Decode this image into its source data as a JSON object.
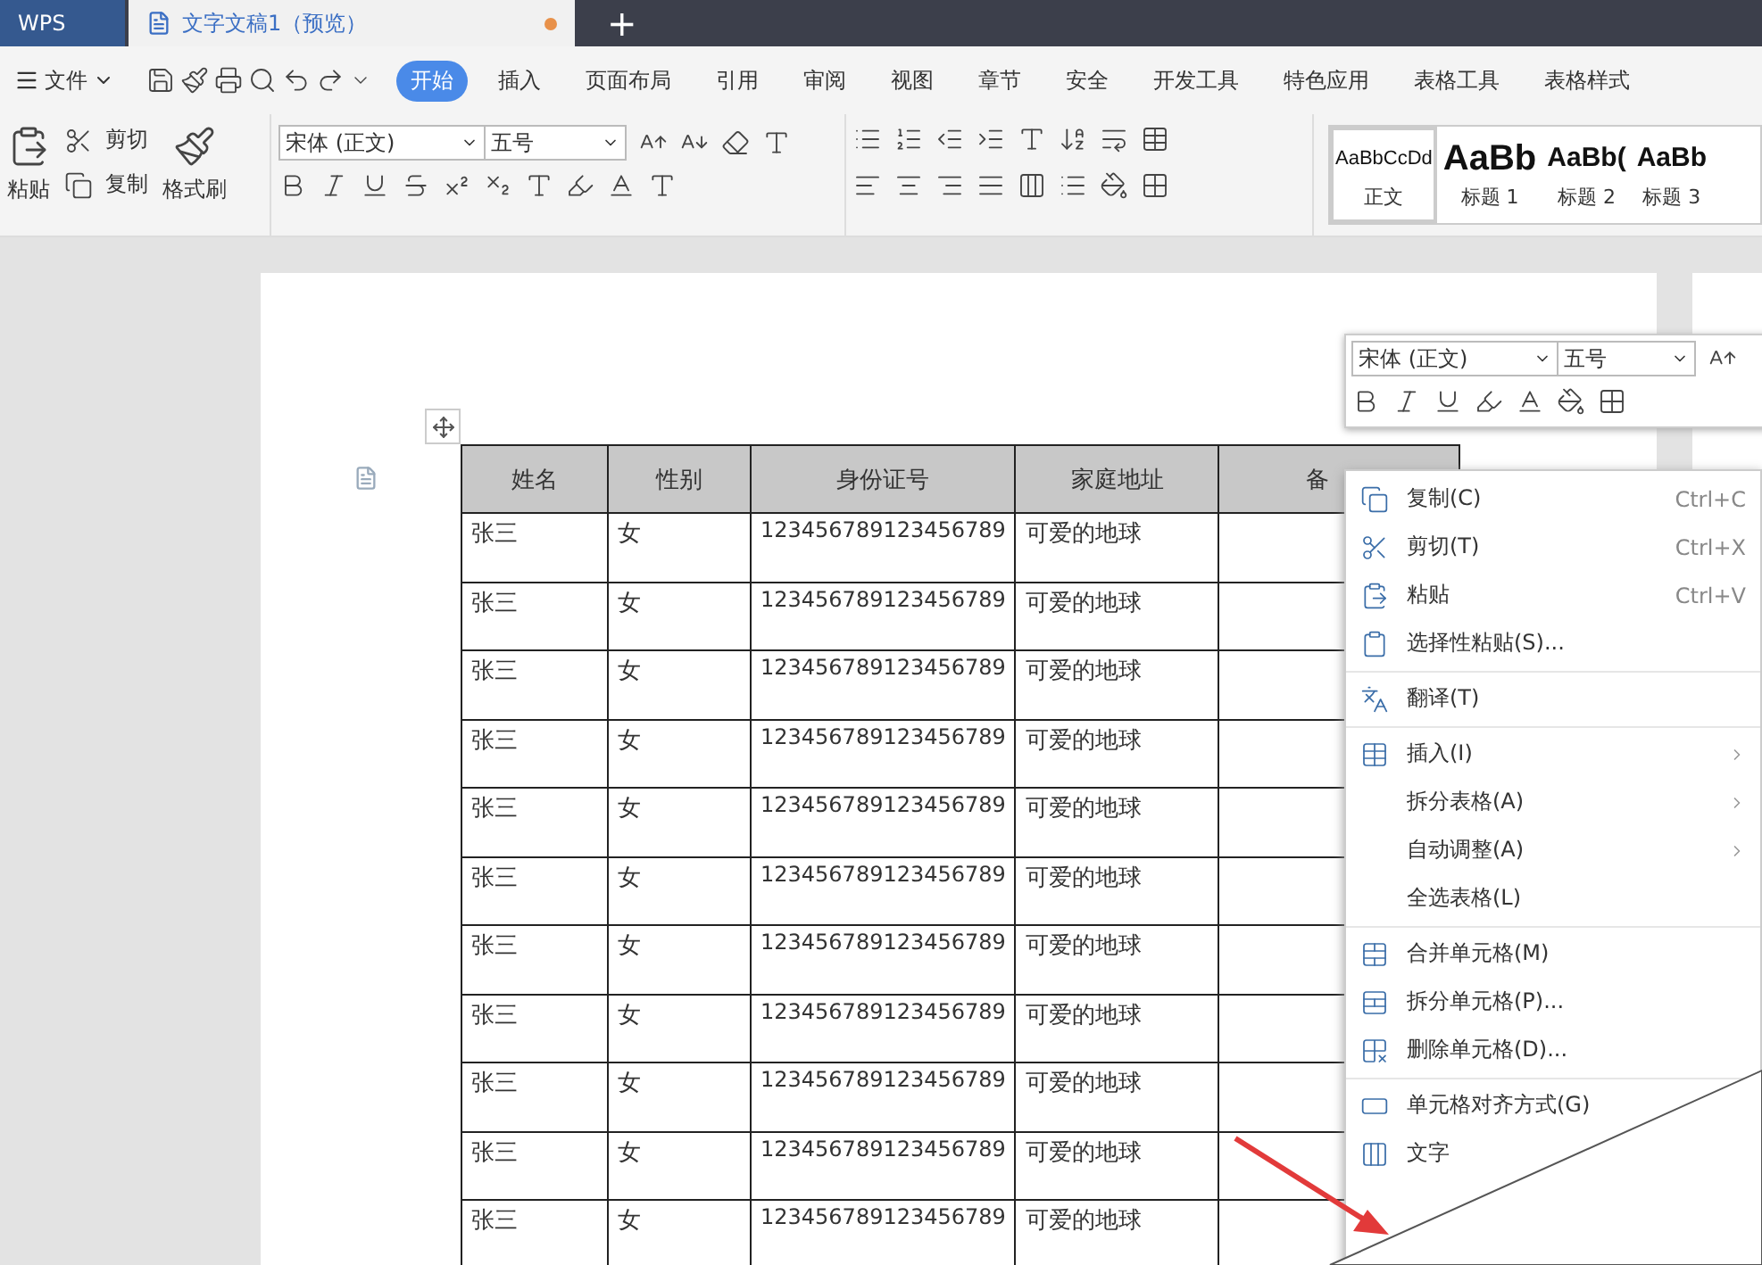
{
  "window_tabs": [
    {
      "label": "WPS",
      "kind": "home",
      "selected": false
    },
    {
      "label": "文字文稿1（预览）",
      "kind": "doc",
      "selected": true,
      "unsaved": true
    }
  ],
  "new_tab": "+",
  "menu": {
    "file": "文件",
    "tabs": [
      {
        "label": "开始",
        "selected": true
      },
      {
        "label": "插入",
        "selected": false
      },
      {
        "label": "页面布局",
        "selected": false
      },
      {
        "label": "引用",
        "selected": false
      },
      {
        "label": "审阅",
        "selected": false
      },
      {
        "label": "视图",
        "selected": false
      },
      {
        "label": "章节",
        "selected": false
      },
      {
        "label": "安全",
        "selected": false
      },
      {
        "label": "开发工具",
        "selected": false
      },
      {
        "label": "特色应用",
        "selected": false
      },
      {
        "label": "表格工具",
        "selected": false
      },
      {
        "label": "表格样式",
        "selected": false
      }
    ]
  },
  "ribbon": {
    "paste": "粘贴",
    "cut": "剪切",
    "copy": "复制",
    "format_painter": "格式刷",
    "font": "宋体 (正文)",
    "size": "五号",
    "styles": [
      {
        "preview": "AaBbCcDd",
        "label": "正文",
        "selected": true,
        "kind": "body"
      },
      {
        "preview": "AaBb",
        "label": "标题 1",
        "selected": false,
        "kind": "h1"
      },
      {
        "preview": "AaBb(",
        "label": "标题 2",
        "selected": false,
        "kind": "h2"
      },
      {
        "preview": "AaBb",
        "label": "标题 3",
        "selected": false,
        "kind": "h2"
      }
    ]
  },
  "table": {
    "columns": [
      "姓名",
      "性别",
      "身份证号",
      "家庭地址",
      "备"
    ],
    "rows": [
      [
        "张三",
        "女",
        "123456789123456789",
        "可爱的地球"
      ],
      [
        "张三",
        "女",
        "123456789123456789",
        "可爱的地球"
      ],
      [
        "张三",
        "女",
        "123456789123456789",
        "可爱的地球"
      ],
      [
        "张三",
        "女",
        "123456789123456789",
        "可爱的地球"
      ],
      [
        "张三",
        "女",
        "123456789123456789",
        "可爱的地球"
      ],
      [
        "张三",
        "女",
        "123456789123456789",
        "可爱的地球"
      ],
      [
        "张三",
        "女",
        "123456789123456789",
        "可爱的地球"
      ],
      [
        "张三",
        "女",
        "123456789123456789",
        "可爱的地球"
      ],
      [
        "张三",
        "女",
        "123456789123456789",
        "可爱的地球"
      ],
      [
        "张三",
        "女",
        "123456789123456789",
        "可爱的地球"
      ],
      [
        "张三",
        "女",
        "123456789123456789",
        "可爱的地球"
      ]
    ]
  },
  "mini_toolbar": {
    "font": "宋体 (正文)",
    "size": "五号"
  },
  "context_menu": [
    {
      "label": "复制(C)",
      "shortcut": "Ctrl+C",
      "submenu": false,
      "divider_after": false
    },
    {
      "label": "剪切(T)",
      "shortcut": "Ctrl+X",
      "submenu": false,
      "divider_after": false
    },
    {
      "label": "粘贴",
      "shortcut": "Ctrl+V",
      "submenu": false,
      "divider_after": false
    },
    {
      "label": "选择性粘贴(S)...",
      "submenu": false,
      "divider_after": true
    },
    {
      "label": "翻译(T)",
      "submenu": false,
      "divider_after": true
    },
    {
      "label": "插入(I)",
      "submenu": true,
      "divider_after": false
    },
    {
      "label": "拆分表格(A)",
      "submenu": true,
      "divider_after": false
    },
    {
      "label": "自动调整(A)",
      "submenu": true,
      "divider_after": false
    },
    {
      "label": "全选表格(L)",
      "submenu": false,
      "divider_after": true
    },
    {
      "label": "合并单元格(M)",
      "submenu": false,
      "divider_after": false
    },
    {
      "label": "拆分单元格(P)...",
      "submenu": false,
      "divider_after": false
    },
    {
      "label": "删除单元格(D)...",
      "submenu": false,
      "divider_after": true
    },
    {
      "label": "单元格对齐方式(G)",
      "submenu": false,
      "divider_after": false
    },
    {
      "label": "文字",
      "submenu": false,
      "divider_after": false
    }
  ]
}
